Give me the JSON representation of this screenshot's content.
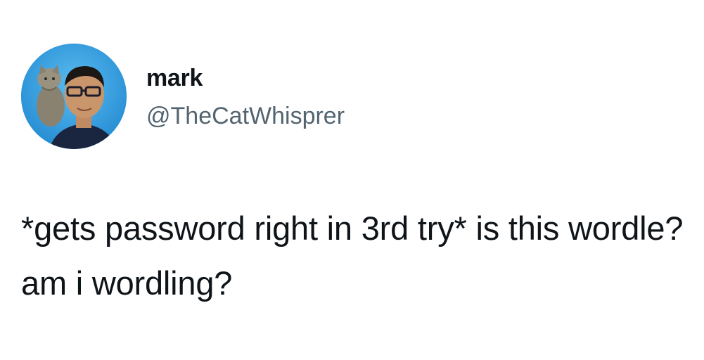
{
  "author": {
    "name": "mark",
    "handle": "@TheCatWhisprer"
  },
  "tweet": {
    "text": "*gets password right in 3rd try* is this wordle? am i wordling?"
  },
  "colors": {
    "name": "#0f1419",
    "handle": "#536471",
    "text": "#0f1419",
    "avatar_background": "#2f9fe0"
  }
}
